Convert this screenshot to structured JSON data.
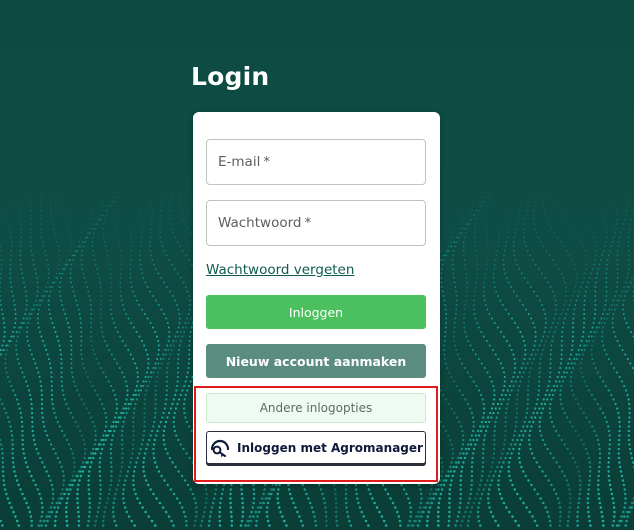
{
  "page": {
    "title": "Login"
  },
  "form": {
    "email_label": "E-mail",
    "password_label": "Wachtwoord",
    "required_marker": "*",
    "forgot_password": "Wachtwoord vergeten",
    "login_button": "Inloggen",
    "register_button": "Nieuw account aanmaken",
    "other_options_button": "Andere inlogopties",
    "agromanager_button": "Inloggen met Agromanager"
  },
  "colors": {
    "background": "#0d4a42",
    "dots": "#1fbfae",
    "login_button": "#4cbf5f",
    "register_button": "#5a8c80",
    "highlight": "#e01b1b"
  },
  "icons": {
    "agromanager": "agromanager-key-icon"
  }
}
